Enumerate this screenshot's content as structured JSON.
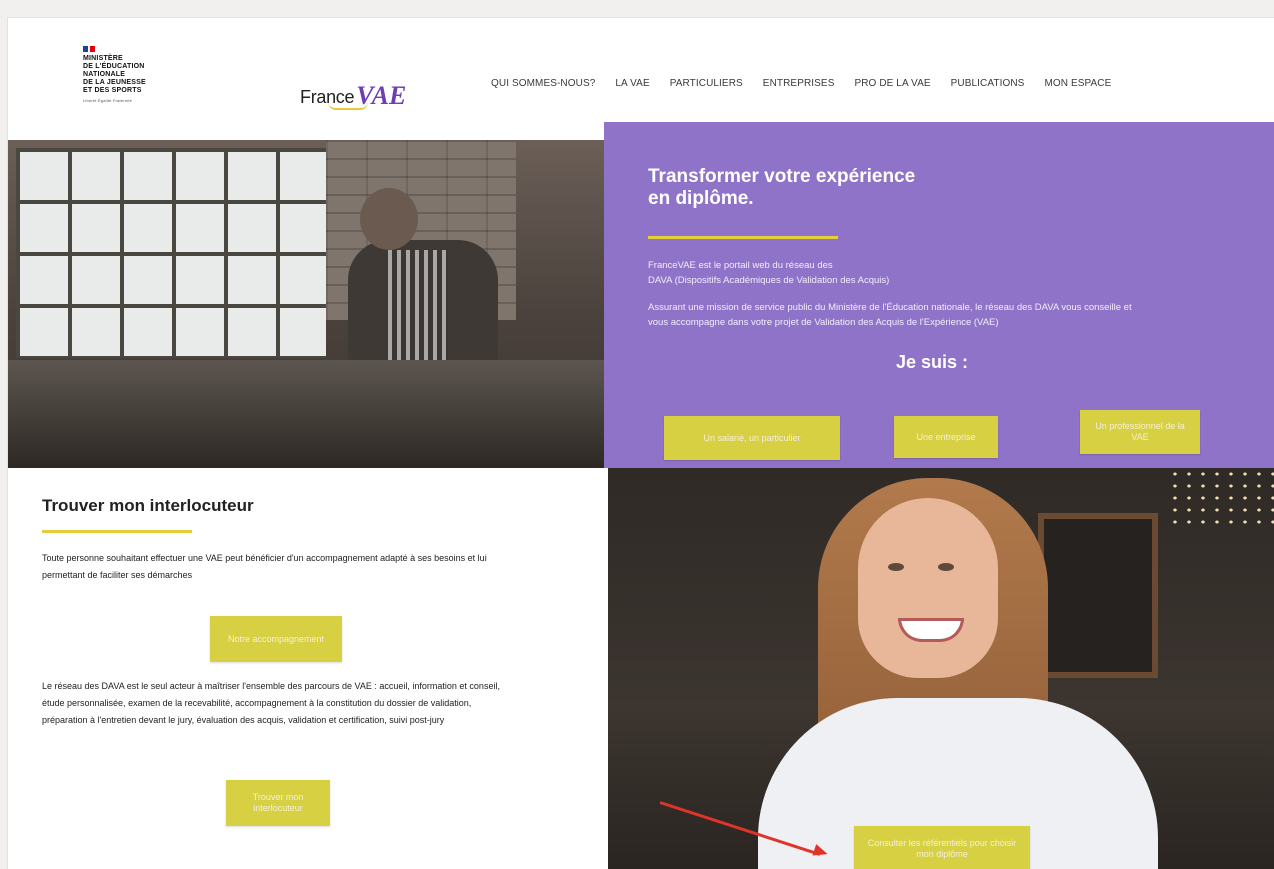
{
  "header": {
    "gov_logo_lines": [
      "MINISTÈRE",
      "DE L'ÉDUCATION",
      "NATIONALE",
      "DE LA JEUNESSE",
      "ET DES SPORTS"
    ],
    "gov_motto": "Liberté Égalité Fraternité",
    "brand_france": "France",
    "brand_vae": "VAE",
    "nav": [
      "QUI SOMMES-NOUS?",
      "LA VAE",
      "PARTICULIERS",
      "ENTREPRISES",
      "PRO DE LA VAE",
      "PUBLICATIONS",
      "MON ESPACE"
    ]
  },
  "hero": {
    "title_line1": "Transformer votre expérience",
    "title_line2": "en diplôme.",
    "para1_line1": "FranceVAE est le portail web du réseau des",
    "para1_line2": "DAVA (Dispositifs Académiques de Validation des Acquis)",
    "para2_line1": "Assurant une mission de service public du Ministère de l'Éducation nationale, le réseau des DAVA vous conseille et",
    "para2_line2": "vous accompagne dans votre projet de Validation des Acquis de l'Expérience (VAE)",
    "je_suis": "Je suis :",
    "buttons": [
      "Un salarié, un particulier",
      "Une entreprise",
      "Un professionnel de la VAE"
    ]
  },
  "info": {
    "title": "Trouver mon interlocuteur",
    "para1": "Toute personne souhaitant effectuer une VAE peut bénéficier d'un accompagnement adapté à ses besoins et lui permettant de faciliter ses démarches",
    "button1": "Notre accompagnement",
    "para2": "Le réseau des DAVA est le seul acteur à maîtriser l'ensemble des parcours de VAE : accueil, information et conseil, étude personnalisée, examen de la recevabilité, accompagnement à la constitution du dossier de validation, préparation à l'entretien devant le jury, évaluation des acquis, validation et certification, suivi post-jury",
    "button2": "Trouver mon interlocuteur"
  },
  "photo_cta": {
    "button": "Consulter les référentiels pour choisir mon diplôme"
  },
  "colors": {
    "purple": "#8f73c8",
    "yellow": "#d8d043",
    "arrow": "#e0342a"
  }
}
